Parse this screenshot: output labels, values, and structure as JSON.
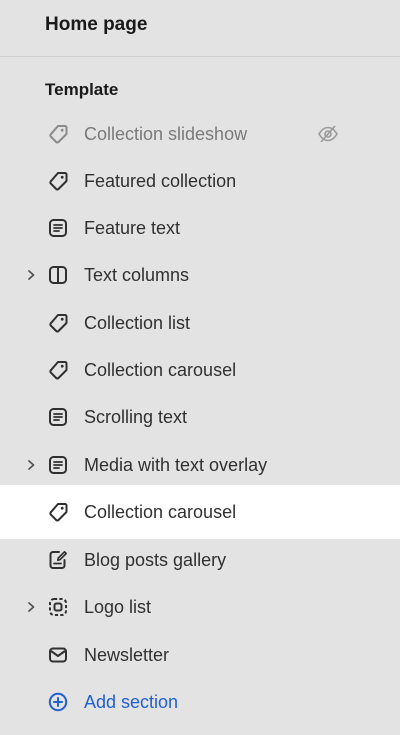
{
  "header": {
    "title": "Home page"
  },
  "template": {
    "heading": "Template",
    "items": [
      {
        "label": "Collection slideshow",
        "icon": "tag-icon",
        "hidden": true
      },
      {
        "label": "Featured collection",
        "icon": "tag-icon"
      },
      {
        "label": "Feature text",
        "icon": "text-block-icon"
      },
      {
        "label": "Text columns",
        "icon": "columns-icon",
        "expandable": true
      },
      {
        "label": "Collection list",
        "icon": "tag-icon"
      },
      {
        "label": "Collection carousel",
        "icon": "tag-icon"
      },
      {
        "label": "Scrolling text",
        "icon": "text-block-icon"
      },
      {
        "label": "Media with text overlay",
        "icon": "text-block-icon",
        "expandable": true
      },
      {
        "label": "Collection carousel",
        "icon": "tag-icon",
        "selected": true
      },
      {
        "label": "Blog posts gallery",
        "icon": "blog-post-icon"
      },
      {
        "label": "Logo list",
        "icon": "logo-icon",
        "expandable": true
      },
      {
        "label": "Newsletter",
        "icon": "envelope-icon"
      }
    ],
    "add_section": {
      "label": "Add section",
      "icon": "plus-circle-icon"
    }
  },
  "colors": {
    "background": "#e3e3e3",
    "selected_background": "#ffffff",
    "link": "#1f5fd1",
    "hidden_text": "#7a7a7a"
  }
}
